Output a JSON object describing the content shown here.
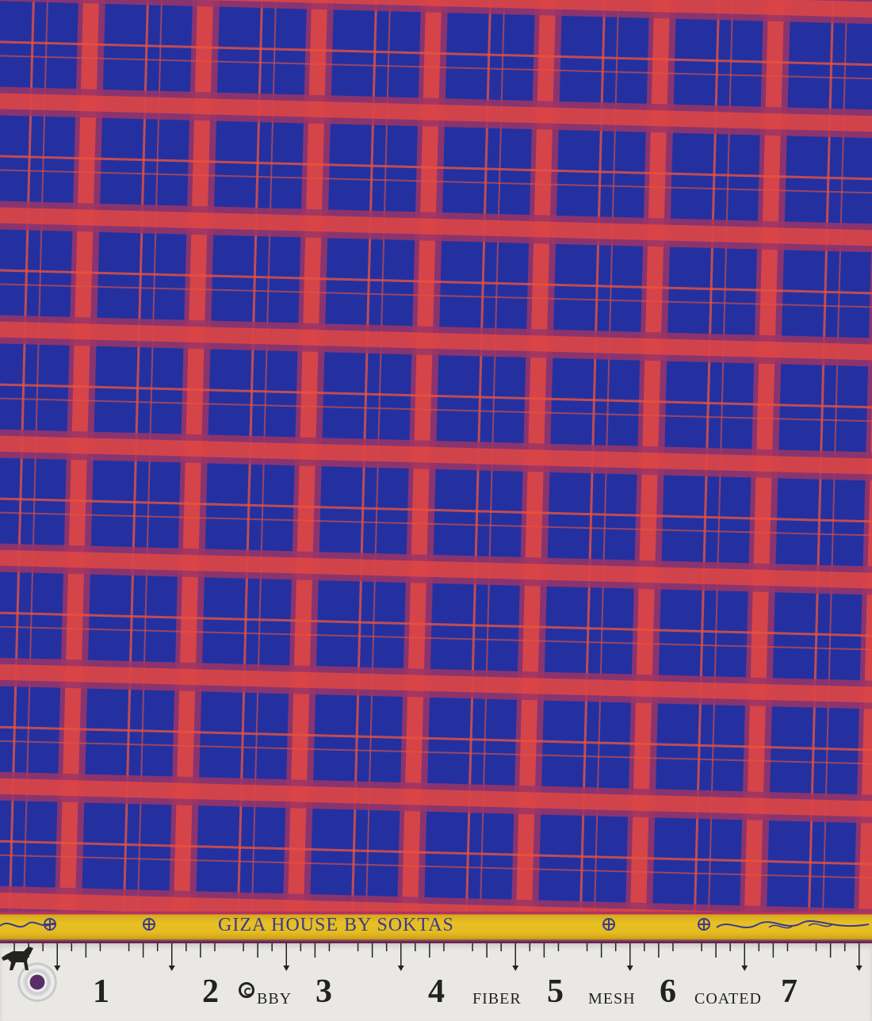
{
  "fabric": {
    "pattern": "plaid",
    "colors": {
      "ground": "#2430a0",
      "red_stripe": "#ef4a3c",
      "maroon_band": "#9b3566",
      "thin_line": "#e8523e"
    }
  },
  "selvedge": {
    "text": "GIZA HOUSE BY SOKTAS",
    "colors": {
      "band": "#e7c025",
      "text": "#3c3a8c"
    }
  },
  "ruler": {
    "numbers": [
      "1",
      "2",
      "3",
      "4",
      "5",
      "6",
      "7"
    ],
    "words": [
      "BBY",
      "FIBER",
      "MESH",
      "COATED"
    ],
    "colors": {
      "background": "#e9e8e4",
      "ink": "#222222"
    },
    "icons": [
      "grommet-icon",
      "horse-icon",
      "copyright-icon"
    ]
  }
}
